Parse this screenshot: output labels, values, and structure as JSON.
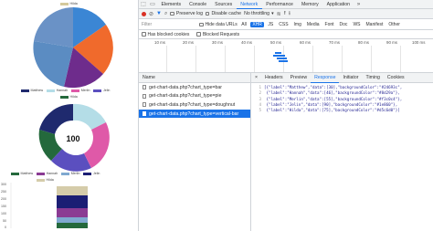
{
  "page": {
    "charts": [
      {
        "type": "pie",
        "categories": [
          "Matthew",
          "Hannah",
          "Merlin",
          "Jelin",
          "Hilda"
        ],
        "values": [
          30,
          46,
          55,
          90,
          75
        ],
        "colors": [
          "#24693c",
          "#8d29a",
          "#f3c0c4",
          "#1e860",
          "#d5c6d0"
        ],
        "legend_visible": [
          "Hilda"
        ]
      },
      {
        "type": "doughnut",
        "center_label": "100",
        "legend": [
          "Matthew",
          "Hannah",
          "Merlin",
          "Jelin",
          "Hilda"
        ],
        "values": [
          30,
          46,
          55,
          90,
          75
        ]
      },
      {
        "type": "bar",
        "legend": [
          "Matthew",
          "Hannah",
          "Merlin",
          "Jelin",
          "Hilda"
        ],
        "y_ticks": [
          "300",
          "250",
          "200",
          "150",
          "100",
          "50",
          "0"
        ],
        "values": [
          30,
          46,
          55,
          90,
          75
        ]
      }
    ]
  },
  "devtools": {
    "tabs": [
      "Elements",
      "Console",
      "Sources",
      "Network",
      "Performance",
      "Memory",
      "Application"
    ],
    "active_tab": "Network",
    "toolbar": {
      "preserve_log": "Preserve log",
      "disable_cache": "Disable cache",
      "throttling": "No throttling"
    },
    "filter": {
      "label": "Filter",
      "hide_data_urls": "Hide data URLs",
      "types": [
        "All",
        "XHR",
        "JS",
        "CSS",
        "Img",
        "Media",
        "Font",
        "Doc",
        "WS",
        "Manifest",
        "Other"
      ],
      "active_type": "XHR"
    },
    "blocked": {
      "cookies": "Has blocked cookies",
      "requests": "Blocked Requests"
    },
    "timeline_ticks": [
      "10 ms",
      "20 ms",
      "30 ms",
      "40 ms",
      "50 ms",
      "60 ms",
      "70 ms",
      "80 ms",
      "90 ms",
      "100 ms"
    ],
    "requests_header": "Name",
    "requests": [
      "get-chart-data.php?chart_type=bar",
      "get-chart-data.php?chart_type=pie",
      "get-chart-data.php?chart_type=doughnut",
      "get-chart-data.php?chart_type=vertical-bar"
    ],
    "selected_request": 3,
    "detail_tabs": [
      "×",
      "Headers",
      "Preview",
      "Response",
      "Initiator",
      "Timing",
      "Cookies"
    ],
    "active_detail_tab": "Response",
    "response_lines": [
      "[{\"label\":\"Matthew\",\"data\":[30],\"backgroundColor\":\"#24693c\",",
      " {\"label\":\"Hannah\",\"data\":[46],\"backgroundColor\":\"#8d29a\"},",
      " {\"label\":\"Merlin\",\"data\":[55],\"backgroundColor\":\"#f3c0c4\"},",
      " {\"label\":\"Jelin\",\"data\":[90],\"backgroundColor\":\"#1e860\"},",
      " {\"label\":\"Hilda\",\"data\":[75],\"backgroundColor\":\"#d5c6d0\"}]"
    ]
  }
}
